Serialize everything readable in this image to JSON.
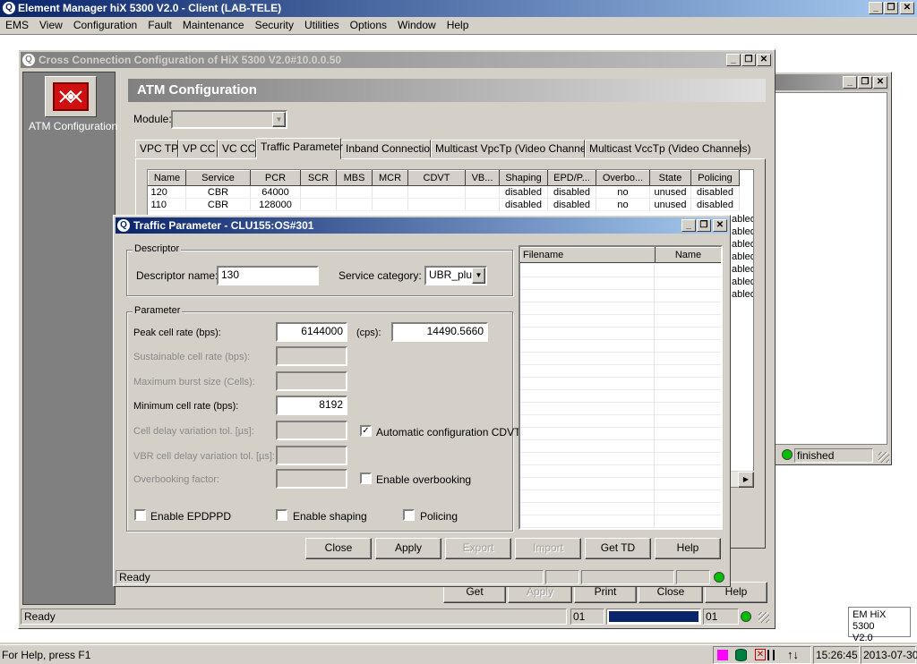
{
  "app": {
    "title": "Element Manager hiX 5300 V2.0 - Client (LAB-TELE)",
    "menu": [
      "EMS",
      "View",
      "Configuration",
      "Fault",
      "Maintenance",
      "Security",
      "Utilities",
      "Options",
      "Window",
      "Help"
    ],
    "ctl": {
      "min": "_",
      "restore": "❐",
      "close": "✕"
    }
  },
  "crossconn": {
    "title": "Cross Connection Configuration of HiX 5300 V2.0#10.0.0.50",
    "nav_label": "ATM Configuration",
    "header": "ATM Configuration",
    "module_label": "Module:",
    "tabs": [
      "VPC TP",
      "VP CC",
      "VC CC",
      "Traffic Parameter",
      "Inband Connection",
      "Multicast VpcTp (Video Channels)",
      "Multicast VccTp (Video Channels)"
    ],
    "table": {
      "columns": [
        "Name",
        "Service",
        "PCR",
        "SCR",
        "MBS",
        "MCR",
        "CDVT",
        "VB...",
        "Shaping",
        "EPD/P...",
        "Overbo...",
        "State",
        "Policing"
      ],
      "rows": [
        [
          "120",
          "CBR",
          "64000",
          "",
          "",
          "",
          "",
          "",
          "disabled",
          "disabled",
          "no",
          "unused",
          "disabled"
        ],
        [
          "110",
          "CBR",
          "128000",
          "",
          "",
          "",
          "",
          "",
          "disabled",
          "disabled",
          "no",
          "unused",
          "disabled"
        ]
      ],
      "hidden_policing": [
        "abled",
        "abled",
        "abled",
        "abled",
        "abled",
        "abled",
        "abled"
      ]
    },
    "bottom_buttons": [
      "Get",
      "Apply",
      "Print",
      "Close",
      "Help"
    ],
    "status_text": "Ready",
    "status_field_1": "01",
    "status_field_2": "01"
  },
  "bgwin": {
    "status_text": "finished"
  },
  "dialog": {
    "title": "Traffic Parameter - CLU155:OS#301",
    "descriptor_group": "Descriptor",
    "descriptor_name_label": "Descriptor name:",
    "descriptor_name": "130",
    "service_category_label": "Service category:",
    "service_category": "UBR_plus",
    "parameter_group": "Parameter",
    "pcr_label": "Peak cell rate (bps):",
    "pcr_value": "6144000",
    "cps_label": "(cps):",
    "cps_value": "14490.5660",
    "scr_label": "Sustainable cell rate (bps):",
    "mbs_label": "Maximum burst size (Cells):",
    "mcr_label": "Minimum cell rate (bps):",
    "mcr_value": "8192",
    "cdvt_label": "Cell delay variation tol. [µs]:",
    "vbr_cdvt_label": "VBR cell delay variation tol. [µs]:",
    "overbooking_label": "Overbooking factor:",
    "auto_cdvt_label": "Automatic configuration CDVT",
    "enable_overbooking_label": "Enable overbooking",
    "enable_epdppd_label": "Enable EPDPPD",
    "enable_shaping_label": "Enable shaping",
    "policing_label": "Policing",
    "file_table_columns": [
      "Filename",
      "Name"
    ],
    "buttons": {
      "close": "Close",
      "apply": "Apply",
      "export": "Export",
      "import": "Import",
      "get_td": "Get TD",
      "help": "Help"
    },
    "status_text": "Ready"
  },
  "side_badge": {
    "line1": "EM HiX 5300",
    "line2": "V2.0"
  },
  "statusbar": {
    "help_text": "For Help, press F1",
    "time": "15:26:45",
    "date": "2013-07-30"
  },
  "colors": {
    "accent_titlebar": "#0a246a",
    "face": "#d4d0c8",
    "progress": "#0a246a",
    "led_green": "#00c000",
    "magenta": "#ff00ff"
  }
}
